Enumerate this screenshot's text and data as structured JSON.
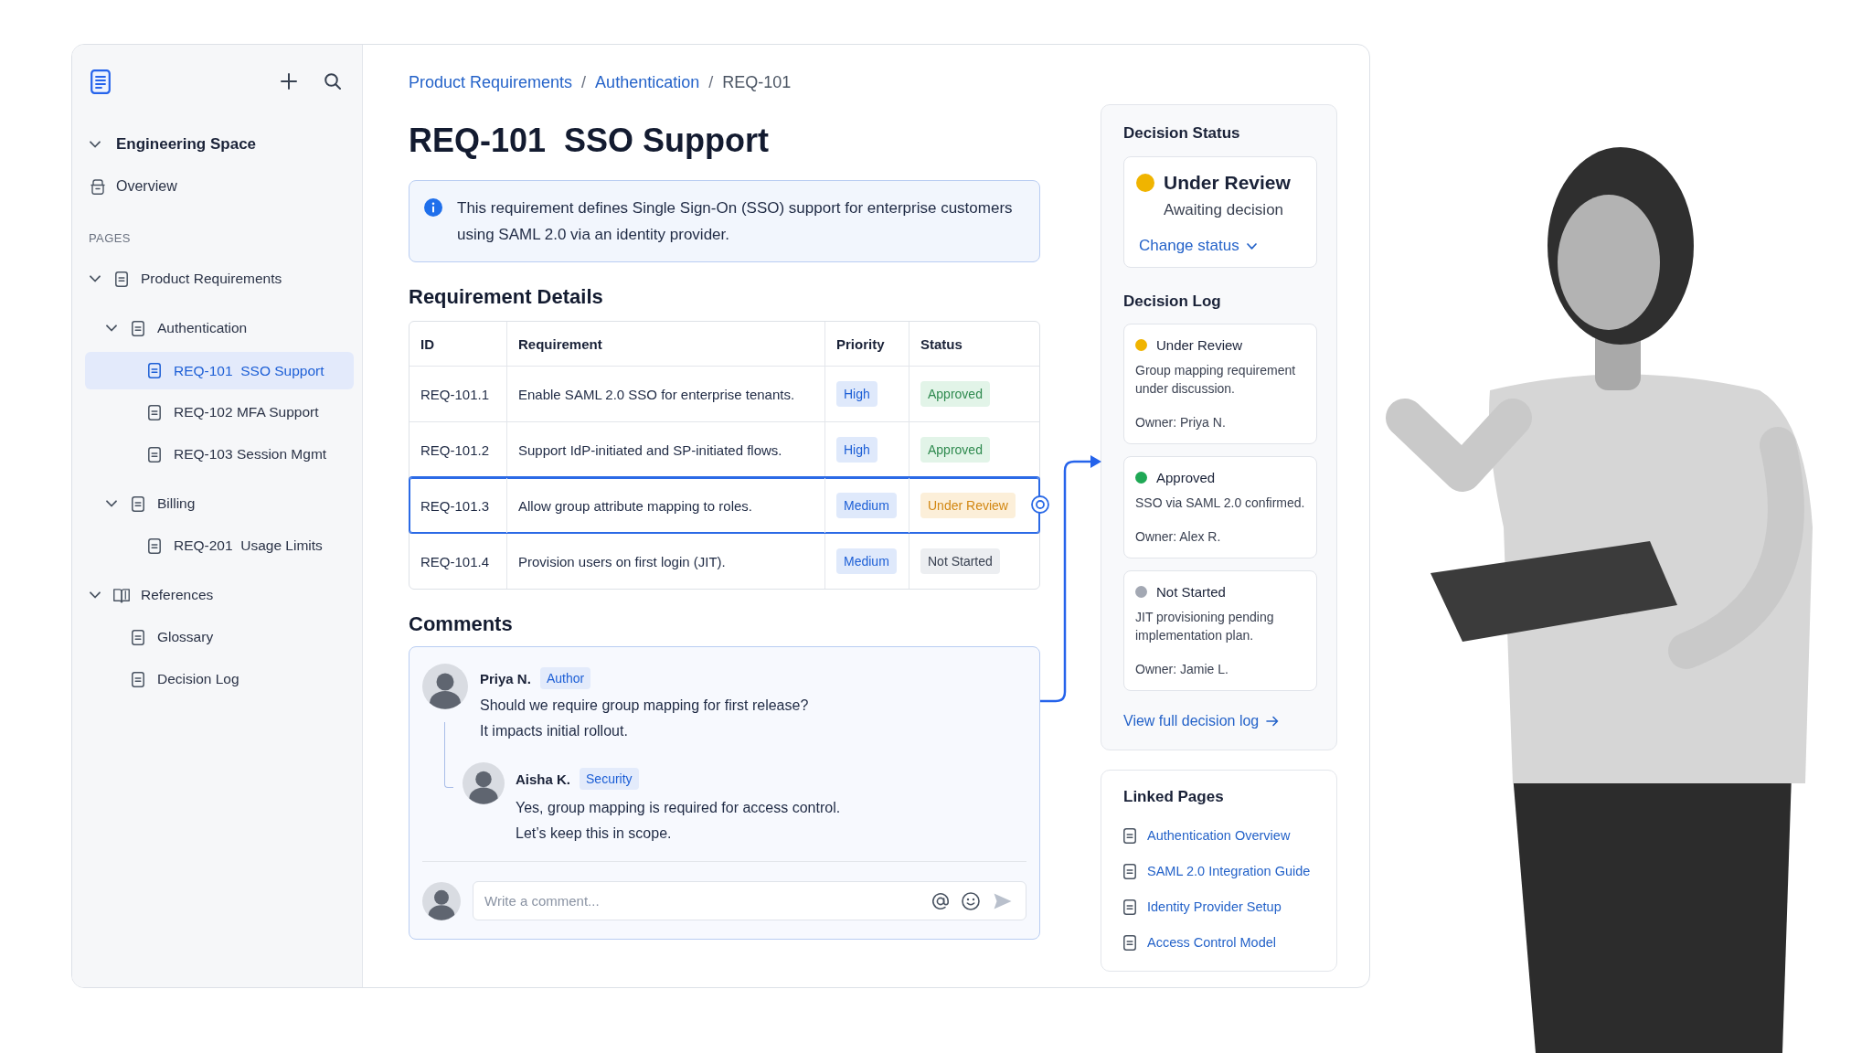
{
  "sidebar": {
    "space": {
      "label": "Engineering Space",
      "expanded": true
    },
    "links": [
      {
        "label": "Overview",
        "kind": "overview"
      }
    ],
    "section": "PAGES",
    "tree": [
      {
        "label": "Product Requirements",
        "kind": "page",
        "expanded": true,
        "selected": false,
        "children": [
          {
            "label": "Authentication",
            "kind": "page",
            "expanded": true,
            "selected": false,
            "children": [
              {
                "label": "REQ-101  SSO Support",
                "kind": "page",
                "selected": true
              },
              {
                "label": "REQ-102 MFA Support",
                "kind": "page",
                "selected": false
              },
              {
                "label": "REQ-103 Session Mgmt",
                "kind": "page",
                "selected": false
              }
            ]
          },
          {
            "label": "Billing",
            "kind": "page",
            "expanded": true,
            "selected": false,
            "children": [
              {
                "label": "REQ-201  Usage Limits",
                "kind": "page",
                "selected": false
              }
            ]
          }
        ]
      },
      {
        "label": "References",
        "kind": "book",
        "expanded": true,
        "selected": false,
        "children": [
          {
            "label": "Glossary",
            "kind": "page",
            "selected": false
          },
          {
            "label": "Decision Log",
            "kind": "page",
            "selected": false
          }
        ]
      }
    ]
  },
  "breadcrumb": [
    {
      "kind": "link",
      "label": "Product Requirements"
    },
    {
      "kind": "separator",
      "label": "/"
    },
    {
      "kind": "link",
      "label": "Authentication"
    },
    {
      "kind": "separator",
      "label": "/"
    },
    {
      "kind": "current",
      "label": "REQ-101"
    }
  ],
  "page": {
    "title": "REQ-101  SSO Support",
    "info": "This requirement defines Single Sign-On (SSO) support for enterprise customers using SAML 2.0 via an identity provider."
  },
  "requirements": {
    "title": "Requirement Details",
    "columns": [
      "ID",
      "Requirement",
      "Priority",
      "Status"
    ],
    "rows": [
      {
        "id": "REQ-101.1",
        "requirement": "Enable SAML 2.0 SSO for enterprise tenants.",
        "priority": "High",
        "status": {
          "label": "Approved",
          "kind": "approved"
        },
        "selected": false
      },
      {
        "id": "REQ-101.2",
        "requirement": "Support IdP-initiated and SP-initiated flows.",
        "priority": "High",
        "status": {
          "label": "Approved",
          "kind": "approved"
        },
        "selected": false
      },
      {
        "id": "REQ-101.3",
        "requirement": "Allow group attribute mapping to roles.",
        "priority": "Medium",
        "status": {
          "label": "Under Review",
          "kind": "under_review"
        },
        "selected": true
      },
      {
        "id": "REQ-101.4",
        "requirement": "Provision users on first login (JIT).",
        "priority": "Medium",
        "status": {
          "label": "Not Started",
          "kind": "not_started"
        },
        "selected": false
      }
    ]
  },
  "comments": {
    "title": "Comments",
    "thread": [
      {
        "author": "Priya N.",
        "role": "Author",
        "lines": [
          "Should we require group mapping for first release?",
          "It impacts initial rollout."
        ],
        "replies": [
          {
            "author": "Aisha K.",
            "role": "Security",
            "lines": [
              "Yes, group mapping is required for access control.",
              "Let’s keep this in scope."
            ]
          }
        ]
      }
    ],
    "composer": {
      "placeholder": "Write a comment..."
    }
  },
  "decision_status": {
    "title": "Decision Status",
    "status": "Under Review",
    "color": "#f0b400",
    "note": "Awaiting decision",
    "action": "Change status"
  },
  "decision_log": {
    "title": "Decision Log",
    "entries": [
      {
        "status": "Under Review",
        "color": "#f0b400",
        "text": "Group mapping requirement under discussion.",
        "owner": "Owner: Priya N."
      },
      {
        "status": "Approved",
        "color": "#1fa855",
        "text": "SSO via SAML 2.0 confirmed.",
        "owner": "Owner: Alex R."
      },
      {
        "status": "Not Started",
        "color": "#a3a8b3",
        "text": "JIT provisioning pending implementation plan.",
        "owner": "Owner: Jamie L."
      }
    ],
    "link": "View full decision log"
  },
  "linked_pages": {
    "title": "Linked Pages",
    "items": [
      "Authentication Overview",
      "SAML 2.0 Integration Guide",
      "Identity Provider Setup",
      "Access Control Model"
    ]
  }
}
